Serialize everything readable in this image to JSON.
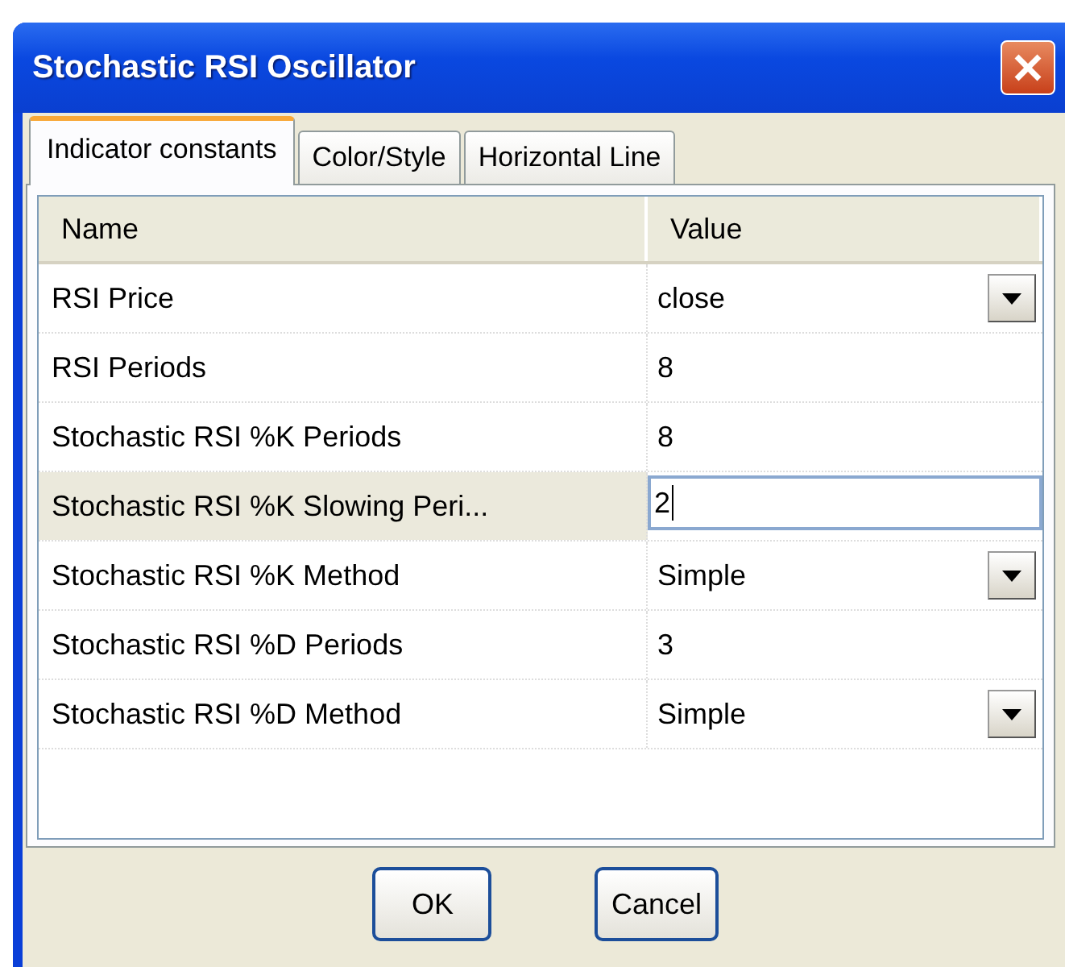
{
  "window": {
    "title": "Stochastic RSI Oscillator"
  },
  "tabs": [
    {
      "label": "Indicator constants",
      "selected": true
    },
    {
      "label": "Color/Style",
      "selected": false
    },
    {
      "label": "Horizontal Line",
      "selected": false
    }
  ],
  "table": {
    "columns": [
      "Name",
      "Value"
    ],
    "rows": [
      {
        "name": "RSI Price",
        "value": "close",
        "kind": "dropdown",
        "selected": false
      },
      {
        "name": "RSI Periods",
        "value": "8",
        "kind": "text",
        "selected": false
      },
      {
        "name": "Stochastic RSI %K Periods",
        "value": "8",
        "kind": "text",
        "selected": false
      },
      {
        "name": "Stochastic RSI %K Slowing Peri...",
        "value": "2",
        "kind": "editing",
        "selected": true
      },
      {
        "name": "Stochastic RSI %K Method",
        "value": "Simple",
        "kind": "dropdown",
        "selected": false
      },
      {
        "name": "Stochastic RSI %D Periods",
        "value": "3",
        "kind": "text",
        "selected": false
      },
      {
        "name": "Stochastic RSI %D Method",
        "value": "Simple",
        "kind": "dropdown",
        "selected": false
      }
    ]
  },
  "buttons": [
    "OK",
    "Cancel"
  ]
}
